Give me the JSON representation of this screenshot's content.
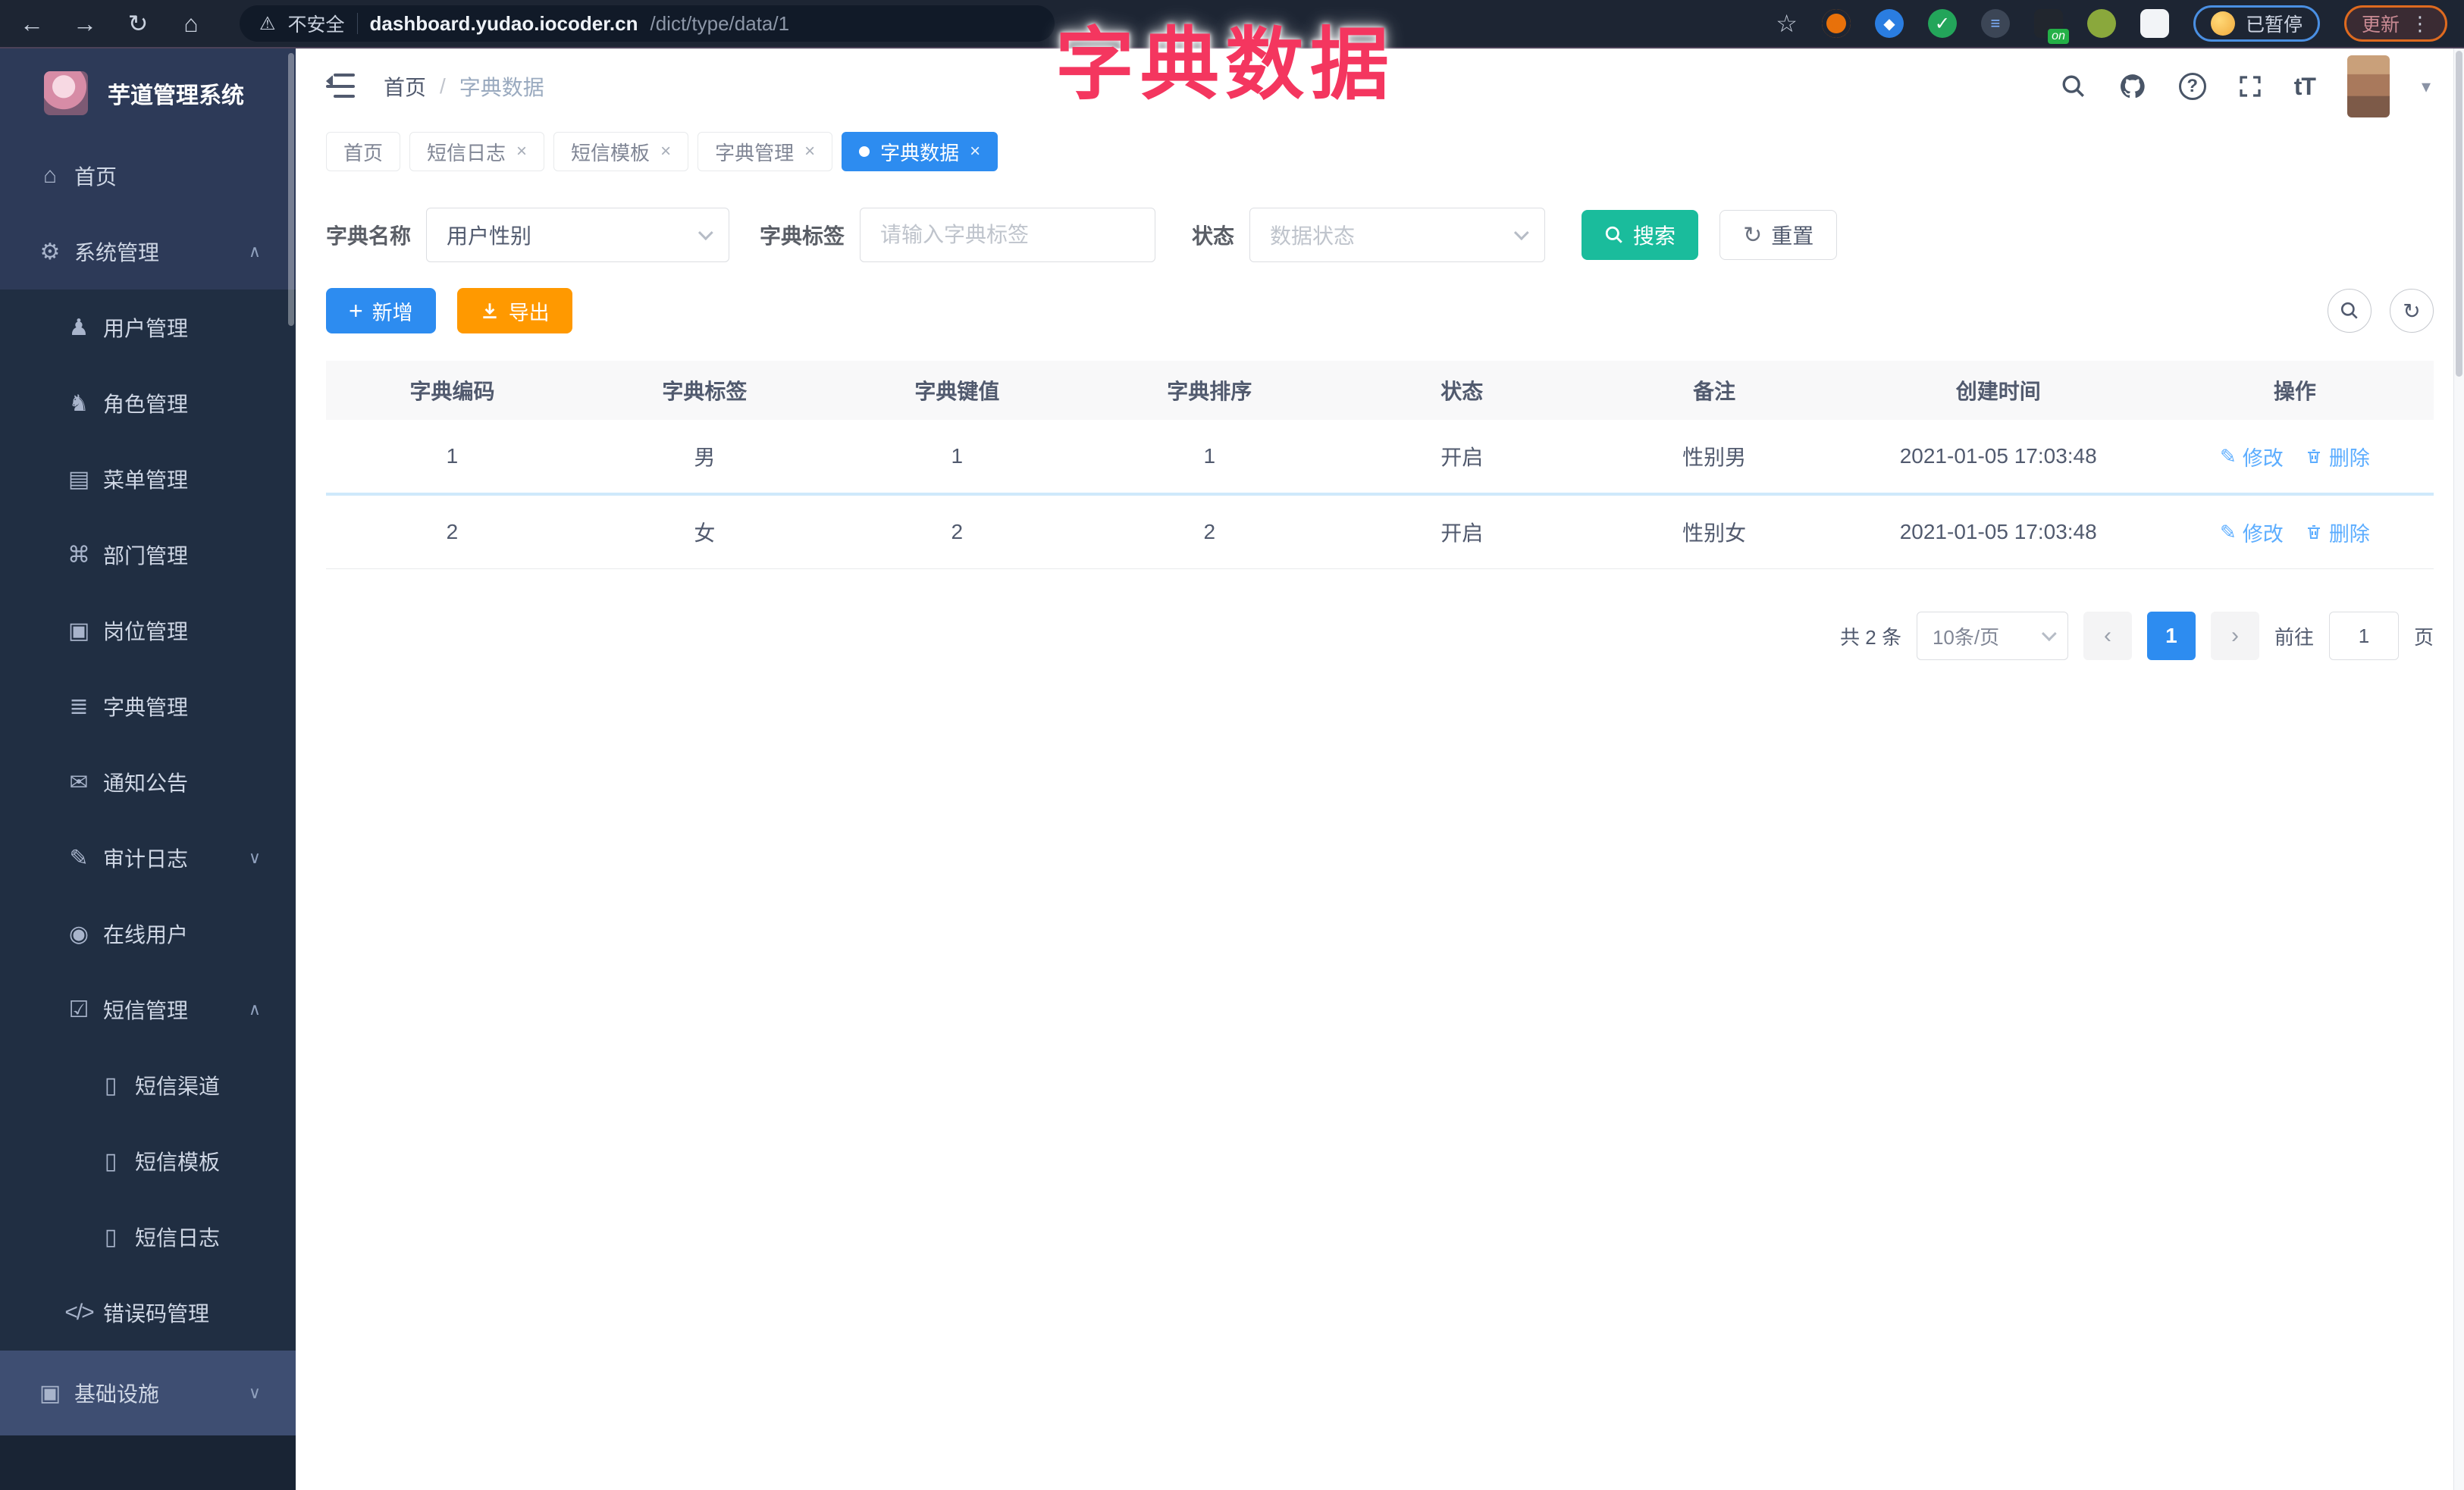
{
  "browser": {
    "back_icon": "←",
    "forward_icon": "→",
    "reload_icon": "↻",
    "home_icon": "⌂",
    "warning_icon": "⚠",
    "security_label": "不安全",
    "url_host": "dashboard.yudao.iocoder.cn",
    "url_path": "/dict/type/data/1",
    "star_icon": "☆",
    "sliders_icon": "≡",
    "check_icon": "✓",
    "on_badge": "on",
    "paused_label": "已暂停",
    "update_label": "更新",
    "kebab_icon": "⋮"
  },
  "overlay_title": "字典数据",
  "sidebar": {
    "logo_title": "芋道管理系统",
    "items": [
      {
        "glyph": "⌂",
        "label": "首页"
      },
      {
        "glyph": "⚙",
        "label": "系统管理",
        "arrow": "∧"
      },
      {
        "glyph": "♟",
        "label": "用户管理"
      },
      {
        "glyph": "♞",
        "label": "角色管理"
      },
      {
        "glyph": "▤",
        "label": "菜单管理"
      },
      {
        "glyph": "⌘",
        "label": "部门管理"
      },
      {
        "glyph": "▣",
        "label": "岗位管理"
      },
      {
        "glyph": "≣",
        "label": "字典管理"
      },
      {
        "glyph": "✉",
        "label": "通知公告"
      },
      {
        "glyph": "✎",
        "label": "审计日志",
        "arrow": "∨"
      },
      {
        "glyph": "◉",
        "label": "在线用户"
      },
      {
        "glyph": "☑",
        "label": "短信管理",
        "arrow": "∧"
      },
      {
        "glyph": "▯",
        "label": "短信渠道"
      },
      {
        "glyph": "▯",
        "label": "短信模板"
      },
      {
        "glyph": "▯",
        "label": "短信日志"
      },
      {
        "glyph": "</>",
        "label": "错误码管理"
      },
      {
        "glyph": "▣",
        "label": "基础设施",
        "arrow": "∨"
      }
    ]
  },
  "header": {
    "breadcrumb_home": "首页",
    "breadcrumb_sep": "/",
    "breadcrumb_current": "字典数据",
    "help_icon": "?",
    "font_icon": "tT",
    "caret_icon": "▾"
  },
  "tabs": {
    "close_glyph": "×",
    "items": [
      {
        "label": "首页"
      },
      {
        "label": "短信日志"
      },
      {
        "label": "短信模板"
      },
      {
        "label": "字典管理"
      },
      {
        "label": "字典数据"
      }
    ]
  },
  "filters": {
    "name_label": "字典名称",
    "name_value": "用户性别",
    "tag_label": "字典标签",
    "tag_placeholder": "请输入字典标签",
    "status_label": "状态",
    "status_placeholder": "数据状态",
    "search_label": "搜索",
    "reset_icon": "↻",
    "reset_label": "重置"
  },
  "toolbar": {
    "add_icon": "+",
    "add_label": "新增",
    "export_label": "导出",
    "refresh_icon": "↻"
  },
  "table": {
    "columns": [
      "字典编码",
      "字典标签",
      "字典键值",
      "字典排序",
      "状态",
      "备注",
      "创建时间",
      "操作"
    ],
    "rows": [
      {
        "code": "1",
        "label": "男",
        "value": "1",
        "sort": "1",
        "status": "开启",
        "remark": "性别男",
        "created": "2021-01-05 17:03:48"
      },
      {
        "code": "2",
        "label": "女",
        "value": "2",
        "sort": "2",
        "status": "开启",
        "remark": "性别女",
        "created": "2021-01-05 17:03:48"
      }
    ],
    "edit_glyph": "✎",
    "edit_label": "修改",
    "delete_label": "删除"
  },
  "pagination": {
    "total_text": "共 2 条",
    "page_size_value": "10条/页",
    "prev_icon": "‹",
    "next_icon": "›",
    "current_page": "1",
    "goto_label": "前往",
    "goto_value": "1",
    "page_unit": "页"
  }
}
